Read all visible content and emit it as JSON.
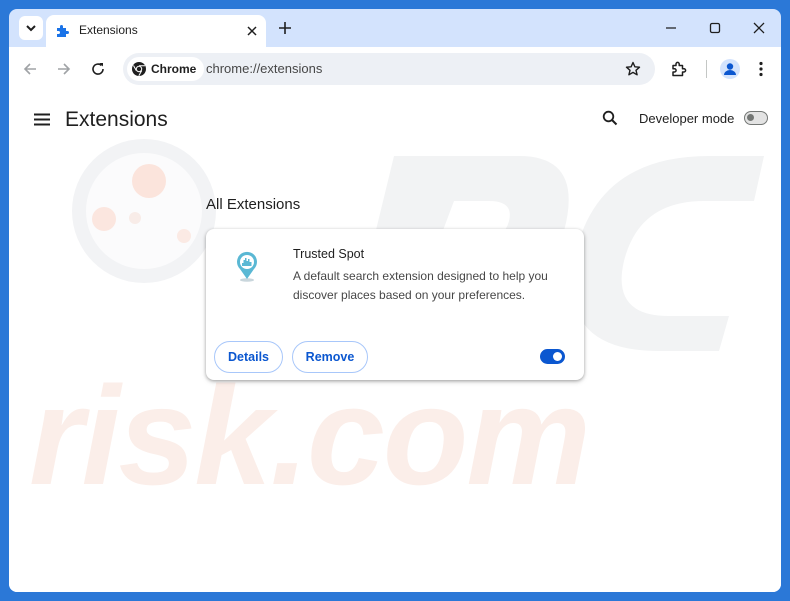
{
  "tab": {
    "title": "Extensions"
  },
  "toolbar": {
    "chip_label": "Chrome",
    "url": "chrome://extensions"
  },
  "page": {
    "title": "Extensions",
    "developer_mode_label": "Developer mode",
    "developer_mode_enabled": false,
    "section_title": "All Extensions"
  },
  "extension": {
    "name": "Trusted Spot",
    "description": "A default search extension designed to help you discover places based on your preferences.",
    "details_label": "Details",
    "remove_label": "Remove",
    "enabled": true
  },
  "watermark": {
    "text": "risk.com"
  },
  "colors": {
    "accent": "#0b57d0",
    "frame": "#d3e3fd",
    "desktop": "#2b78d7"
  }
}
